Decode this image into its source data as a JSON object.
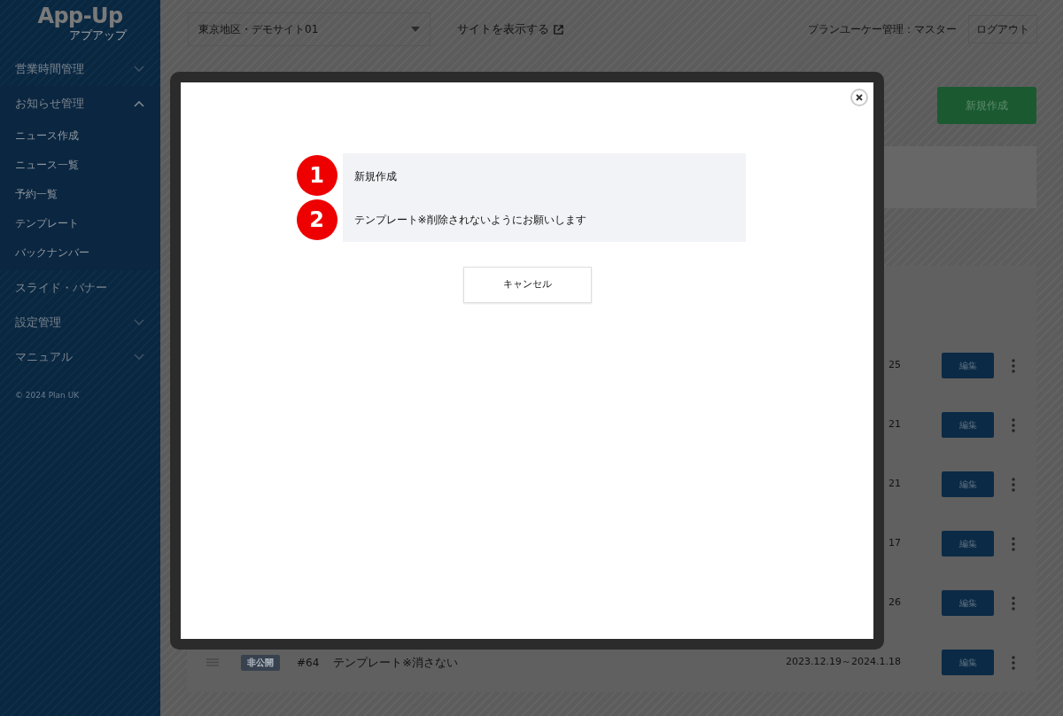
{
  "sidebar": {
    "logo": "App-Up",
    "logo_reading": "アプアップ",
    "items": [
      {
        "label": "営業時間管理",
        "kind": "group",
        "expanded": false
      },
      {
        "label": "お知らせ管理",
        "kind": "group",
        "expanded": true,
        "children": [
          {
            "label": "ニュース作成"
          },
          {
            "label": "ニュース一覧"
          },
          {
            "label": "予約一覧"
          },
          {
            "label": "テンプレート"
          },
          {
            "label": "バックナンバー"
          }
        ]
      },
      {
        "label": "スライド・バナー",
        "kind": "link"
      },
      {
        "label": "設定管理",
        "kind": "group",
        "expanded": false
      },
      {
        "label": "マニュアル",
        "kind": "group",
        "expanded": false
      }
    ],
    "copyright": "© 2024 Plan UK"
  },
  "header": {
    "site_select": "東京地区・デモサイト01",
    "view_site": "サイトを表示する",
    "user": "プランユーケー管理：マスター",
    "logout": "ログアウト"
  },
  "new_button": "新規作成",
  "rows": [
    {
      "kind": "covered",
      "date": "25",
      "edit": "編集"
    },
    {
      "kind": "covered",
      "date": "21",
      "edit": "編集"
    },
    {
      "kind": "covered",
      "date": "21",
      "edit": "編集"
    },
    {
      "kind": "covered",
      "date": "17",
      "edit": "編集"
    },
    {
      "kind": "covered",
      "date": "26",
      "edit": "編集"
    },
    {
      "kind": "full",
      "status": "非公開",
      "number": "#64",
      "title": "テンプレート※消さない",
      "date": "2023.12.19～2024.1.18",
      "edit": "編集"
    }
  ],
  "modal": {
    "options": [
      {
        "badge": "1",
        "label": "新規作成"
      },
      {
        "badge": "2",
        "label": "テンプレート※削除されないようにお願いします"
      }
    ],
    "cancel": "キャンセル"
  }
}
